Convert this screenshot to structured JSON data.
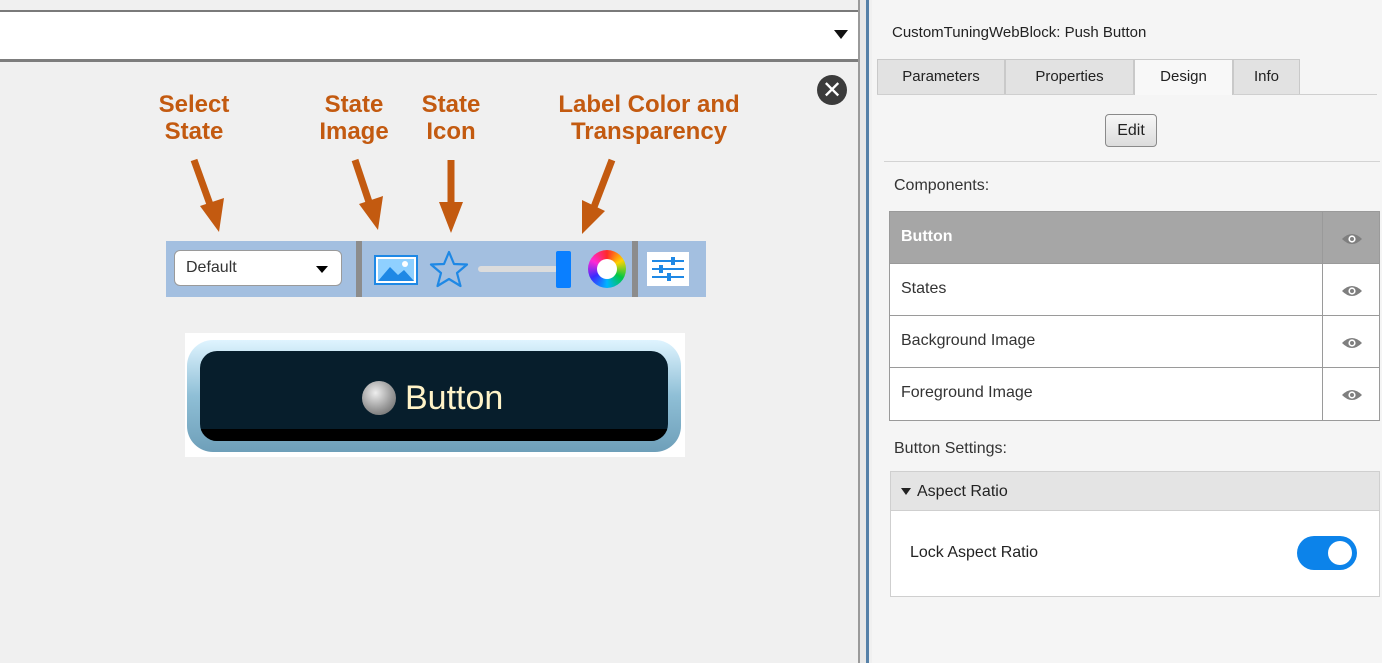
{
  "left_pane": {
    "close_icon": "circle-x-icon",
    "callouts": {
      "select_state": "Select\nState",
      "state_image": "State\nImage",
      "state_icon": "State\nIcon",
      "label_color": "Label Color and\nTransparency"
    },
    "toolbar": {
      "state_select_value": "Default",
      "image_icon": "image-icon",
      "star_icon": "star-icon",
      "color_wheel_icon": "color-wheel-icon",
      "settings_icon": "sliders-icon",
      "transparency_level": 1.0
    },
    "preview": {
      "button_label": "Button"
    }
  },
  "inspector": {
    "title": "CustomTuningWebBlock: Push Button",
    "tabs": [
      {
        "label": "Parameters",
        "active": false
      },
      {
        "label": "Properties",
        "active": false
      },
      {
        "label": "Design",
        "active": true
      },
      {
        "label": "Info",
        "active": false
      }
    ],
    "edit_label": "Edit",
    "components_label": "Components:",
    "components": [
      {
        "name": "Button",
        "selected": true
      },
      {
        "name": "States",
        "selected": false
      },
      {
        "name": "Background Image",
        "selected": false
      },
      {
        "name": "Foreground Image",
        "selected": false
      }
    ],
    "button_settings_label": "Button Settings:",
    "aspect_ratio": {
      "header": "Aspect Ratio",
      "lock_label": "Lock Aspect Ratio",
      "lock_enabled": true
    }
  },
  "colors": {
    "callout": "#c35a10",
    "toolbar_bg": "#a3bfe0",
    "accent_blue": "#0c83ea",
    "selected_row": "#a6a6a6"
  }
}
